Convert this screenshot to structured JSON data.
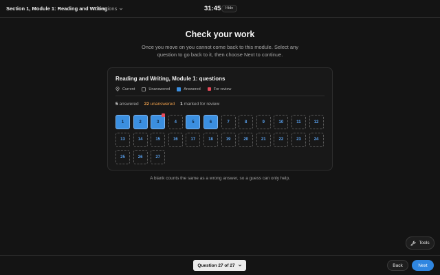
{
  "header": {
    "section_title": "Section 1, Module 1: Reading and Writing",
    "directions_label": "Directions",
    "timer": "31:45",
    "hide_label": "Hide"
  },
  "main": {
    "title": "Check your work",
    "instructions": "Once you move on you cannot come back to this module. Select any question to go back to it, then choose Next to continue.",
    "footnote": "A blank counts the same as a wrong answer, so a guess can only help."
  },
  "card": {
    "title": "Reading and Writing, Module 1: questions",
    "legend": {
      "current": "Current",
      "unanswered": "Unanswered",
      "answered": "Answered",
      "for_review": "For review"
    },
    "summary": {
      "answered_count": "5",
      "answered_label": "answered",
      "unanswered_count": "22",
      "unanswered_label": "unanswered",
      "review_count": "1",
      "review_label": "marked for review"
    },
    "questions": [
      {
        "n": "1",
        "answered": true,
        "review": false
      },
      {
        "n": "2",
        "answered": true,
        "review": false
      },
      {
        "n": "3",
        "answered": true,
        "review": true
      },
      {
        "n": "4",
        "answered": false,
        "review": false
      },
      {
        "n": "5",
        "answered": true,
        "review": false
      },
      {
        "n": "6",
        "answered": true,
        "review": false
      },
      {
        "n": "7",
        "answered": false,
        "review": false
      },
      {
        "n": "8",
        "answered": false,
        "review": false
      },
      {
        "n": "9",
        "answered": false,
        "review": false
      },
      {
        "n": "10",
        "answered": false,
        "review": false
      },
      {
        "n": "11",
        "answered": false,
        "review": false
      },
      {
        "n": "12",
        "answered": false,
        "review": false
      },
      {
        "n": "13",
        "answered": false,
        "review": false
      },
      {
        "n": "14",
        "answered": false,
        "review": false
      },
      {
        "n": "15",
        "answered": false,
        "review": false
      },
      {
        "n": "16",
        "answered": false,
        "review": false
      },
      {
        "n": "17",
        "answered": false,
        "review": false
      },
      {
        "n": "18",
        "answered": false,
        "review": false
      },
      {
        "n": "19",
        "answered": false,
        "review": false
      },
      {
        "n": "20",
        "answered": false,
        "review": false
      },
      {
        "n": "21",
        "answered": false,
        "review": false
      },
      {
        "n": "22",
        "answered": false,
        "review": false
      },
      {
        "n": "23",
        "answered": false,
        "review": false
      },
      {
        "n": "24",
        "answered": false,
        "review": false
      },
      {
        "n": "25",
        "answered": false,
        "review": false
      },
      {
        "n": "26",
        "answered": false,
        "review": false
      },
      {
        "n": "27",
        "answered": false,
        "review": false
      }
    ]
  },
  "tools_label": "Tools",
  "footer": {
    "question_nav": "Question 27 of 27",
    "back_label": "Back",
    "next_label": "Next"
  },
  "colors": {
    "answered": "#3b8fe0",
    "review": "#e84a5a",
    "unanswered_text": "#f0a04b",
    "next_button": "#2f86e0"
  },
  "icons": {
    "directions": "chevron-down-icon",
    "current": "location-pin-icon",
    "tools": "wrench-icon",
    "question_nav": "chevron-down-icon"
  }
}
